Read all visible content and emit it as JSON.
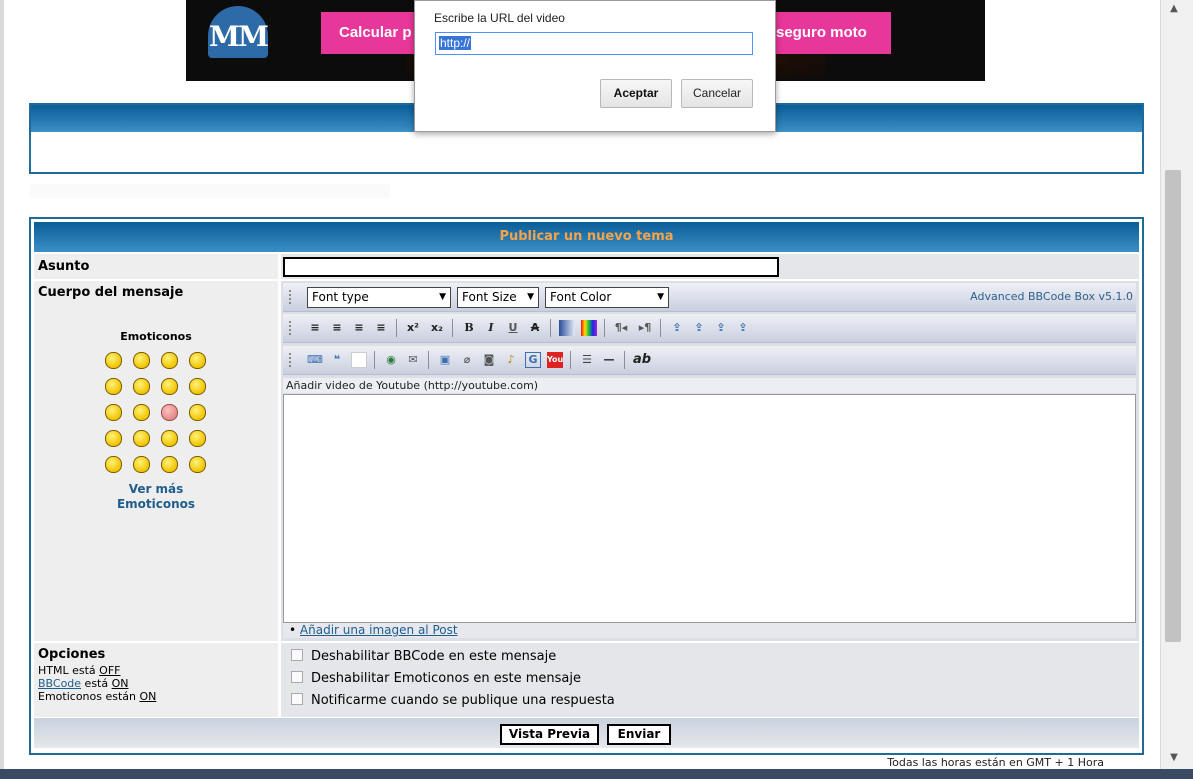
{
  "ad": {
    "logo_text": "MM",
    "left_button": "Calcular p",
    "right_button": "seguro moto"
  },
  "dialog": {
    "prompt": "Escribe la URL del video",
    "input_value": "http://",
    "ok_label": "Aceptar",
    "cancel_label": "Cancelar"
  },
  "form": {
    "title": "Publicar un nuevo tema",
    "subject_label": "Asunto",
    "body_label": "Cuerpo del mensaje",
    "emoticons_title": "Emoticonos",
    "more_emoticons_1": "Ver más",
    "more_emoticons_2": "Emoticonos",
    "font_type": "Font type",
    "font_size": "Font Size",
    "font_color": "Font Color",
    "bbcode_version": "Advanced BBCode Box v5.1.0",
    "toolbar_hint": "Añadir video de Youtube (http://youtube.com)",
    "add_image_link": "Añadir una imagen al Post",
    "options_label": "Opciones",
    "html_status_prefix": "HTML está ",
    "html_status": "OFF",
    "bbcode_word": "BBCode",
    "bbcode_status_prefix": " está ",
    "bbcode_status": "ON",
    "emoticons_status_prefix": "Emoticonos están ",
    "emoticons_status": "ON",
    "checkbox_bbcode": "Deshabilitar BBCode en este mensaje",
    "checkbox_emoticons": "Deshabilitar Emoticonos en este mensaje",
    "checkbox_notify": "Notificarme cuando se publique una respuesta",
    "preview_button": "Vista Previa",
    "send_button": "Enviar"
  },
  "toolbar2": {
    "superscript": "x²",
    "subscript": "x₂",
    "bold": "B",
    "italic": "I",
    "underline": "U",
    "strike": "A"
  },
  "toolbar3": {
    "abbr": "ab"
  },
  "timezone": "Todas las horas están en GMT + 1 Hora",
  "colors": {
    "header_blue": "#0a5d96",
    "title_orange": "#f7a34a",
    "link_blue": "#1f5d8c",
    "ad_pink": "#e8379a"
  }
}
